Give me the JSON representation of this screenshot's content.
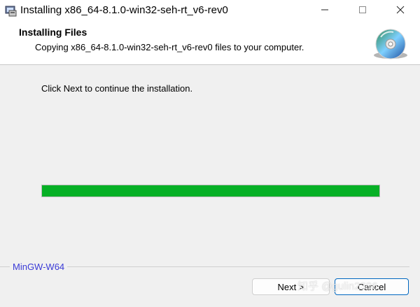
{
  "window": {
    "title": "Installing x86_64-8.1.0-win32-seh-rt_v6-rev0",
    "controls": {
      "minimize_icon": "minimize-icon",
      "maximize_icon": "maximize-icon",
      "close_icon": "close-icon"
    }
  },
  "header": {
    "title": "Installing Files",
    "subtitle": "Copying x86_64-8.1.0-win32-seh-rt_v6-rev0 files to your computer.",
    "icon": "cd-install-icon"
  },
  "body": {
    "instruction": "Click Next to continue the installation.",
    "progress": {
      "value": 1.0,
      "color": "#06b025"
    }
  },
  "branding": {
    "text": "MinGW-W64"
  },
  "buttons": {
    "next_label": "Next >",
    "cancel_label": "Cancel"
  },
  "watermark": {
    "text": "知乎 @gulin2306"
  },
  "colors": {
    "accent": "#0067c0",
    "brand_text": "#3a3ad6"
  }
}
